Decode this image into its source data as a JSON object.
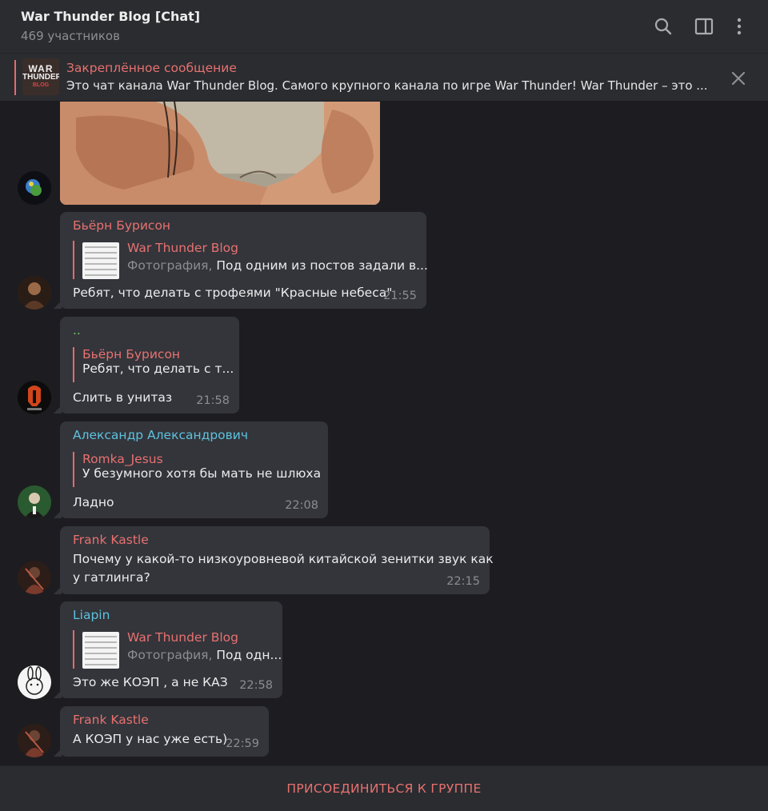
{
  "header": {
    "title": "War Thunder Blog [Chat]",
    "subtitle": "469 участников"
  },
  "pinned": {
    "label": "Закреплённое сообщение",
    "text": "Это чат канала War Thunder Blog. Самого крупного канала по игре War Thunder!  War Thunder – это ...",
    "thumb_lines": [
      "WAR",
      "THUNDER",
      "BLOG"
    ]
  },
  "messages": [
    {
      "sender": "Бьёрн Бурисон",
      "sender_color": "#e8716f",
      "reply_name": "War Thunder Blog",
      "reply_kind": "Фотография,",
      "reply_text": "Под одним из постов задали в...",
      "text": "Ребят, что делать с трофеями \"Красные небеса\"",
      "time": "21:55"
    },
    {
      "sender": "..",
      "sender_color": "#79c36a",
      "reply_name": "Бьёрн Бурисон",
      "reply_text": "Ребят, что делать с т...",
      "text": "Слить в унитаз",
      "time": "21:58"
    },
    {
      "sender": "Александр Александрович",
      "sender_color": "#5ec2de",
      "reply_name": "Romka_Jesus",
      "reply_text": "У безумного хотя бы мать не шлюха",
      "text": "Ладно",
      "time": "22:08"
    },
    {
      "sender": "Frank Kastle",
      "sender_color": "#e8716f",
      "text_lines": [
        "Почему у какой-то низкоуровневой китайской зенитки звук как",
        "у гатлинга?"
      ],
      "time": "22:15"
    },
    {
      "sender": "Liapin",
      "sender_color": "#5ec2de",
      "reply_name": "War Thunder Blog",
      "reply_kind": "Фотография,",
      "reply_text": "Под одн...",
      "text": "Это же КОЭП , а не КАЗ",
      "time": "22:58"
    },
    {
      "sender": "Frank Kastle",
      "sender_color": "#e8716f",
      "text": "А КОЭП у нас уже есть)",
      "time": "22:59"
    }
  ],
  "footer": {
    "join_label": "ПРИСОЕДИНИТЬСЯ К ГРУППЕ"
  },
  "colors": {
    "accent": "#e8716f",
    "bubble": "#33353b",
    "background": "#1d1d21",
    "panel": "#2a2c30"
  },
  "icons": {
    "search": "search-icon",
    "sidebar": "sidebar-toggle-icon",
    "menu": "more-vertical-icon",
    "close": "close-icon"
  }
}
